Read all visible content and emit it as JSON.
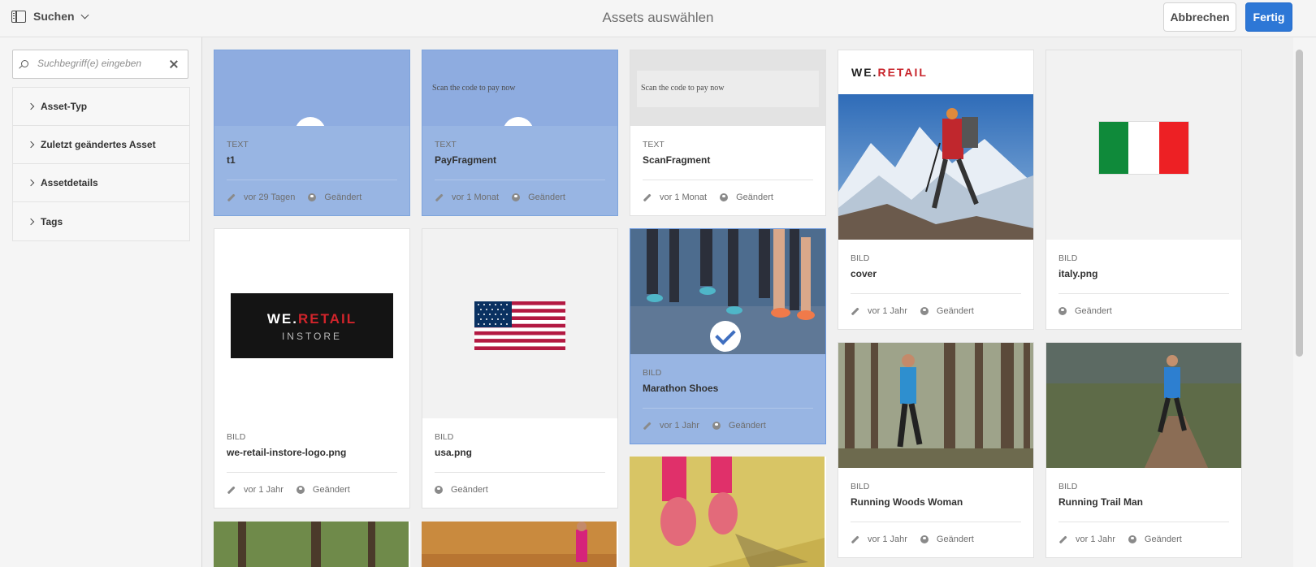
{
  "header": {
    "rail_label": "Suchen",
    "title": "Assets auswählen",
    "cancel_label": "Abbrechen",
    "done_label": "Fertig"
  },
  "sidebar": {
    "search_placeholder": "Suchbegriff(e) eingeben",
    "facets": [
      "Asset-Typ",
      "Zuletzt geändertes Asset",
      "Assetdetails",
      "Tags"
    ]
  },
  "cards": [
    {
      "type": "TEXT",
      "name": "t1",
      "age": "vor 29 Tagen",
      "status": "Geändert",
      "selected": true
    },
    {
      "type": "TEXT",
      "name": "PayFragment",
      "age": "vor 1 Monat",
      "status": "Geändert",
      "selected": true,
      "preview_text": "Scan the code to pay now"
    },
    {
      "type": "TEXT",
      "name": "ScanFragment",
      "age": "vor 1 Monat",
      "status": "Geändert",
      "selected": false,
      "preview_text": "Scan the code to pay now"
    },
    {
      "type": "BILD",
      "name": "cover",
      "age": "vor 1 Jahr",
      "status": "Geändert",
      "selected": false,
      "logo_we": "WE.",
      "logo_retail": "RETAIL"
    },
    {
      "type": "BILD",
      "name": "italy.png",
      "status": "Geändert",
      "selected": false
    },
    {
      "type": "BILD",
      "name": "we-retail-instore-logo.png",
      "age": "vor 1 Jahr",
      "status": "Geändert",
      "selected": false,
      "logo_we": "WE.",
      "logo_retail": "RETAIL",
      "logo_sub": "INSTORE"
    },
    {
      "type": "BILD",
      "name": "usa.png",
      "status": "Geändert",
      "selected": false
    },
    {
      "type": "BILD",
      "name": "Marathon Shoes",
      "age": "vor 1 Jahr",
      "status": "Geändert",
      "selected": true
    },
    {
      "type": "BILD",
      "name": "Running Woods Woman",
      "age": "vor 1 Jahr",
      "status": "Geändert",
      "selected": false
    },
    {
      "type": "BILD",
      "name": "Running Trail Man",
      "age": "vor 1 Jahr",
      "status": "Geändert",
      "selected": false
    }
  ],
  "colors": {
    "accent": "#2d77d6",
    "selected": "#98b5e3",
    "check": "#3f6fc0"
  }
}
